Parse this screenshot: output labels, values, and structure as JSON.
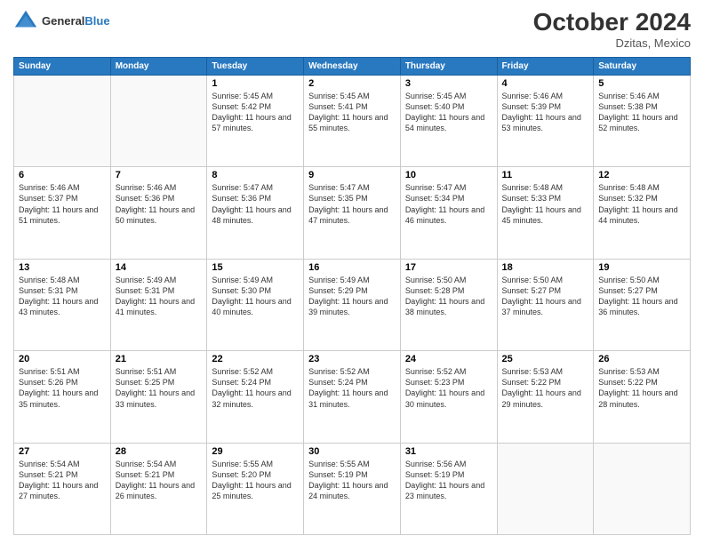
{
  "header": {
    "logo_general": "General",
    "logo_blue": "Blue",
    "month_title": "October 2024",
    "location": "Dzitas, Mexico"
  },
  "days_of_week": [
    "Sunday",
    "Monday",
    "Tuesday",
    "Wednesday",
    "Thursday",
    "Friday",
    "Saturday"
  ],
  "weeks": [
    [
      {
        "day": "",
        "info": ""
      },
      {
        "day": "",
        "info": ""
      },
      {
        "day": "1",
        "info": "Sunrise: 5:45 AM\nSunset: 5:42 PM\nDaylight: 11 hours and 57 minutes."
      },
      {
        "day": "2",
        "info": "Sunrise: 5:45 AM\nSunset: 5:41 PM\nDaylight: 11 hours and 55 minutes."
      },
      {
        "day": "3",
        "info": "Sunrise: 5:45 AM\nSunset: 5:40 PM\nDaylight: 11 hours and 54 minutes."
      },
      {
        "day": "4",
        "info": "Sunrise: 5:46 AM\nSunset: 5:39 PM\nDaylight: 11 hours and 53 minutes."
      },
      {
        "day": "5",
        "info": "Sunrise: 5:46 AM\nSunset: 5:38 PM\nDaylight: 11 hours and 52 minutes."
      }
    ],
    [
      {
        "day": "6",
        "info": "Sunrise: 5:46 AM\nSunset: 5:37 PM\nDaylight: 11 hours and 51 minutes."
      },
      {
        "day": "7",
        "info": "Sunrise: 5:46 AM\nSunset: 5:36 PM\nDaylight: 11 hours and 50 minutes."
      },
      {
        "day": "8",
        "info": "Sunrise: 5:47 AM\nSunset: 5:36 PM\nDaylight: 11 hours and 48 minutes."
      },
      {
        "day": "9",
        "info": "Sunrise: 5:47 AM\nSunset: 5:35 PM\nDaylight: 11 hours and 47 minutes."
      },
      {
        "day": "10",
        "info": "Sunrise: 5:47 AM\nSunset: 5:34 PM\nDaylight: 11 hours and 46 minutes."
      },
      {
        "day": "11",
        "info": "Sunrise: 5:48 AM\nSunset: 5:33 PM\nDaylight: 11 hours and 45 minutes."
      },
      {
        "day": "12",
        "info": "Sunrise: 5:48 AM\nSunset: 5:32 PM\nDaylight: 11 hours and 44 minutes."
      }
    ],
    [
      {
        "day": "13",
        "info": "Sunrise: 5:48 AM\nSunset: 5:31 PM\nDaylight: 11 hours and 43 minutes."
      },
      {
        "day": "14",
        "info": "Sunrise: 5:49 AM\nSunset: 5:31 PM\nDaylight: 11 hours and 41 minutes."
      },
      {
        "day": "15",
        "info": "Sunrise: 5:49 AM\nSunset: 5:30 PM\nDaylight: 11 hours and 40 minutes."
      },
      {
        "day": "16",
        "info": "Sunrise: 5:49 AM\nSunset: 5:29 PM\nDaylight: 11 hours and 39 minutes."
      },
      {
        "day": "17",
        "info": "Sunrise: 5:50 AM\nSunset: 5:28 PM\nDaylight: 11 hours and 38 minutes."
      },
      {
        "day": "18",
        "info": "Sunrise: 5:50 AM\nSunset: 5:27 PM\nDaylight: 11 hours and 37 minutes."
      },
      {
        "day": "19",
        "info": "Sunrise: 5:50 AM\nSunset: 5:27 PM\nDaylight: 11 hours and 36 minutes."
      }
    ],
    [
      {
        "day": "20",
        "info": "Sunrise: 5:51 AM\nSunset: 5:26 PM\nDaylight: 11 hours and 35 minutes."
      },
      {
        "day": "21",
        "info": "Sunrise: 5:51 AM\nSunset: 5:25 PM\nDaylight: 11 hours and 33 minutes."
      },
      {
        "day": "22",
        "info": "Sunrise: 5:52 AM\nSunset: 5:24 PM\nDaylight: 11 hours and 32 minutes."
      },
      {
        "day": "23",
        "info": "Sunrise: 5:52 AM\nSunset: 5:24 PM\nDaylight: 11 hours and 31 minutes."
      },
      {
        "day": "24",
        "info": "Sunrise: 5:52 AM\nSunset: 5:23 PM\nDaylight: 11 hours and 30 minutes."
      },
      {
        "day": "25",
        "info": "Sunrise: 5:53 AM\nSunset: 5:22 PM\nDaylight: 11 hours and 29 minutes."
      },
      {
        "day": "26",
        "info": "Sunrise: 5:53 AM\nSunset: 5:22 PM\nDaylight: 11 hours and 28 minutes."
      }
    ],
    [
      {
        "day": "27",
        "info": "Sunrise: 5:54 AM\nSunset: 5:21 PM\nDaylight: 11 hours and 27 minutes."
      },
      {
        "day": "28",
        "info": "Sunrise: 5:54 AM\nSunset: 5:21 PM\nDaylight: 11 hours and 26 minutes."
      },
      {
        "day": "29",
        "info": "Sunrise: 5:55 AM\nSunset: 5:20 PM\nDaylight: 11 hours and 25 minutes."
      },
      {
        "day": "30",
        "info": "Sunrise: 5:55 AM\nSunset: 5:19 PM\nDaylight: 11 hours and 24 minutes."
      },
      {
        "day": "31",
        "info": "Sunrise: 5:56 AM\nSunset: 5:19 PM\nDaylight: 11 hours and 23 minutes."
      },
      {
        "day": "",
        "info": ""
      },
      {
        "day": "",
        "info": ""
      }
    ]
  ]
}
